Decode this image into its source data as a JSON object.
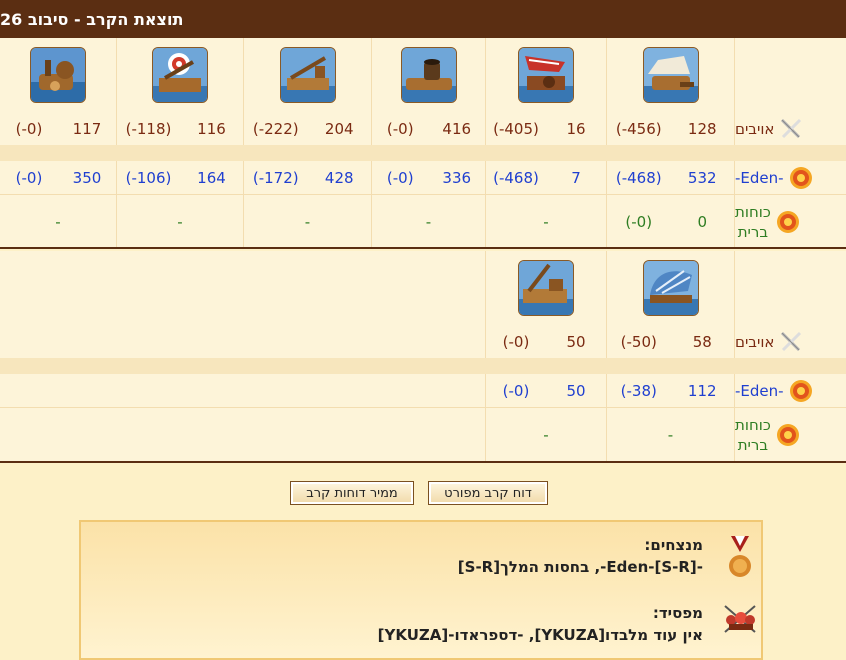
{
  "title": "תוצאת הקרב - סיבוב 26",
  "row_labels": {
    "enemies": "אויבים",
    "own": "-Eden-",
    "allies_line1": "כוחות",
    "allies_line2": "ברית"
  },
  "section1": {
    "units": [
      "ship-catapult",
      "ship-fire",
      "ship-mortar",
      "ship-ram",
      "ship-ballista",
      "ship-submarine"
    ],
    "enemies": [
      {
        "v": "128",
        "l": "(-456)"
      },
      {
        "v": "16",
        "l": "(-405)"
      },
      {
        "v": "416",
        "l": "(-0)"
      },
      {
        "v": "204",
        "l": "(-222)"
      },
      {
        "v": "116",
        "l": "(-118)"
      },
      {
        "v": "117",
        "l": "(-0)"
      }
    ],
    "own": [
      {
        "v": "532",
        "l": "(-468)"
      },
      {
        "v": "7",
        "l": "(-468)"
      },
      {
        "v": "336",
        "l": "(-0)"
      },
      {
        "v": "428",
        "l": "(-172)"
      },
      {
        "v": "164",
        "l": "(-106)"
      },
      {
        "v": "350",
        "l": "(-0)"
      }
    ],
    "allies": [
      {
        "v": "0",
        "l": "(-0)"
      },
      {
        "dash": "-"
      },
      {
        "dash": "-"
      },
      {
        "dash": "-"
      },
      {
        "dash": "-"
      },
      {
        "dash": "-"
      }
    ]
  },
  "section2": {
    "units": [
      "ship-paddle",
      "ship-catapult-2"
    ],
    "enemies": [
      {
        "v": "58",
        "l": "(-50)"
      },
      {
        "v": "50",
        "l": "(-0)"
      }
    ],
    "own": [
      {
        "v": "112",
        "l": "(-38)"
      },
      {
        "v": "50",
        "l": "(-0)"
      }
    ],
    "allies": [
      {
        "dash": "-"
      },
      {
        "dash": "-"
      }
    ]
  },
  "buttons": {
    "detailed": "דוח קרב מפורט",
    "converter": "ממיר דוחות קרב"
  },
  "results": {
    "winners_label": "מנצחים:",
    "winners_value": "-Eden-[S-R]-, בחסות המלך[S-R]",
    "loser_label": "מפסיד:",
    "loser_value": "אין עוד מלבדו[YKUZA], -דספראדו-[YKUZA]"
  }
}
